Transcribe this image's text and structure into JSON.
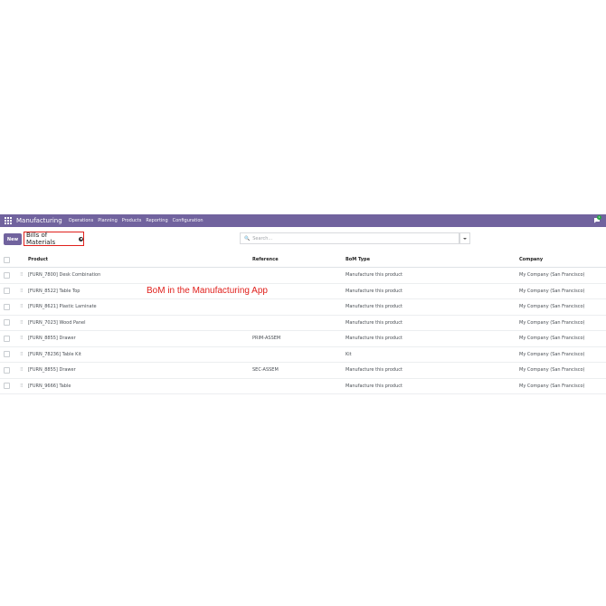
{
  "navbar": {
    "app_name": "Manufacturing",
    "menu": [
      "Operations",
      "Planning",
      "Products",
      "Reporting",
      "Configuration"
    ],
    "chat_badge": "1",
    "accent_color": "#71639e"
  },
  "control_panel": {
    "new_label": "New",
    "breadcrumb": "Bills of Materials",
    "search_placeholder": "Search..."
  },
  "table": {
    "headers": {
      "product": "Product",
      "reference": "Reference",
      "bom_type": "BoM Type",
      "company": "Company"
    },
    "rows": [
      {
        "product": "[FURN_7800] Desk Combination",
        "reference": "",
        "bom_type": "Manufacture this product",
        "company": "My Company (San Francisco)"
      },
      {
        "product": "[FURN_8522] Table Top",
        "reference": "",
        "bom_type": "Manufacture this product",
        "company": "My Company (San Francisco)"
      },
      {
        "product": "[FURN_8621] Plastic Laminate",
        "reference": "",
        "bom_type": "Manufacture this product",
        "company": "My Company (San Francisco)"
      },
      {
        "product": "[FURN_7023] Wood Panel",
        "reference": "",
        "bom_type": "Manufacture this product",
        "company": "My Company (San Francisco)"
      },
      {
        "product": "[FURN_8855] Drawer",
        "reference": "PRIM-ASSEM",
        "bom_type": "Manufacture this product",
        "company": "My Company (San Francisco)"
      },
      {
        "product": "[FURN_78236] Table Kit",
        "reference": "",
        "bom_type": "Kit",
        "company": "My Company (San Francisco)"
      },
      {
        "product": "[FURN_8855] Drawer",
        "reference": "SEC-ASSEM",
        "bom_type": "Manufacture this product",
        "company": "My Company (San Francisco)"
      },
      {
        "product": "[FURN_9666] Table",
        "reference": "",
        "bom_type": "Manufacture this product",
        "company": "My Company (San Francisco)"
      }
    ]
  },
  "annotation": {
    "text": "BoM in the Manufacturing App",
    "color": "#e0201c"
  }
}
